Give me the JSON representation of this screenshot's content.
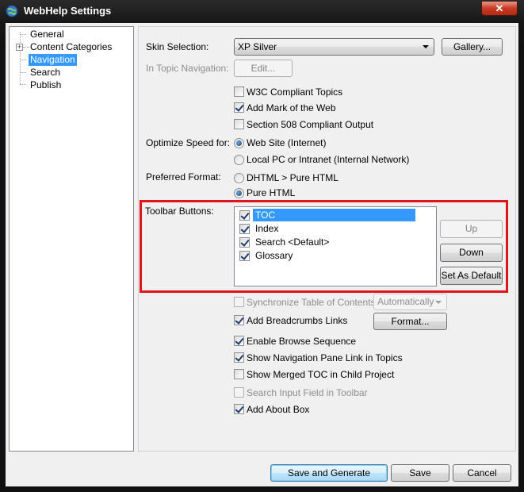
{
  "window": {
    "title": "WebHelp Settings",
    "close_label": "✕"
  },
  "tree": {
    "items": [
      {
        "label": "General"
      },
      {
        "label": "Content Categories",
        "expander": "+"
      },
      {
        "label": "Navigation",
        "selected": true
      },
      {
        "label": "Search"
      },
      {
        "label": "Publish"
      }
    ]
  },
  "skin": {
    "label": "Skin Selection:",
    "value": "XP Silver",
    "gallery_button": "Gallery..."
  },
  "in_topic_nav": {
    "label": "In Topic Navigation:",
    "edit_button": "Edit..."
  },
  "options_top": [
    {
      "label": "W3C Compliant Topics",
      "checked": false
    },
    {
      "label": "Add Mark of the Web",
      "checked": true
    },
    {
      "label": "Section 508 Compliant Output",
      "checked": false
    }
  ],
  "optimize": {
    "label": "Optimize Speed for:",
    "options": [
      {
        "label": "Web Site (Internet)",
        "checked": true
      },
      {
        "label": "Local PC or Intranet (Internal Network)",
        "checked": false
      }
    ]
  },
  "format": {
    "label": "Preferred Format:",
    "options": [
      {
        "label": "DHTML > Pure HTML",
        "checked": false
      },
      {
        "label": "Pure HTML",
        "checked": true
      }
    ]
  },
  "toolbar": {
    "label": "Toolbar Buttons:",
    "items": [
      {
        "label": "TOC",
        "checked": true,
        "selected": true
      },
      {
        "label": "Index",
        "checked": true
      },
      {
        "label": "Search <Default>",
        "checked": true
      },
      {
        "label": "Glossary",
        "checked": true
      }
    ],
    "up_button": "Up",
    "down_button": "Down",
    "default_button": "Set As Default"
  },
  "sync": {
    "label": "Synchronize Table of Contents",
    "value": "Automatically"
  },
  "breadcrumbs": {
    "label": "Add Breadcrumbs Links",
    "format_button": "Format..."
  },
  "options_bottom": [
    {
      "label": "Enable Browse Sequence",
      "checked": true
    },
    {
      "label": "Show Navigation Pane Link in Topics",
      "checked": true
    },
    {
      "label": "Show Merged TOC in Child Project",
      "checked": false
    },
    {
      "label": "Search Input Field in Toolbar",
      "checked": false,
      "disabled": true
    },
    {
      "label": "Add About Box",
      "checked": true
    }
  ],
  "footer": {
    "save_generate": "Save and Generate",
    "save": "Save",
    "cancel": "Cancel"
  },
  "colors": {
    "selection": "#3399ff",
    "highlight_box": "#e0141b"
  }
}
